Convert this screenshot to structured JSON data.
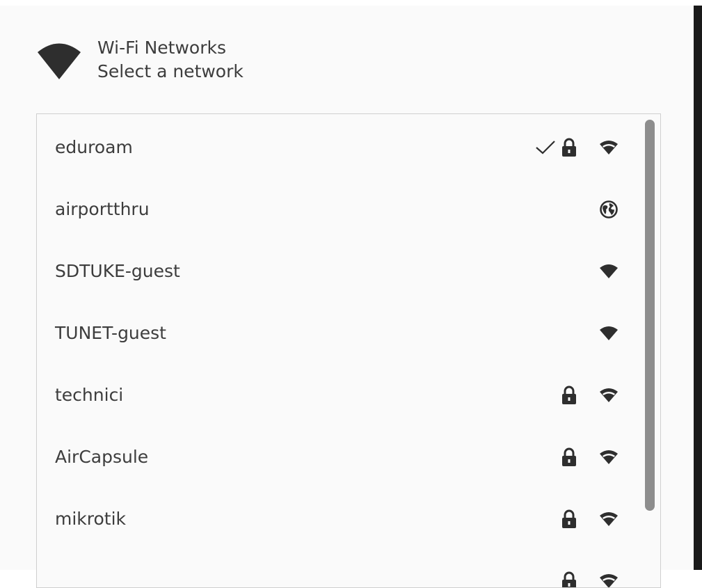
{
  "header": {
    "title": "Wi-Fi Networks",
    "subtitle": "Select a network",
    "icon": "wifi-signal-icon"
  },
  "networks": [
    {
      "name": "eduroam",
      "connected": true,
      "secured": true,
      "signal_icon": "wifi-signal-icon",
      "signal": "outline"
    },
    {
      "name": "airportthru",
      "connected": false,
      "secured": false,
      "signal_icon": "globe-icon",
      "signal": "globe"
    },
    {
      "name": "SDTUKE-guest",
      "connected": false,
      "secured": false,
      "signal_icon": "wifi-signal-icon",
      "signal": "full"
    },
    {
      "name": "TUNET-guest",
      "connected": false,
      "secured": false,
      "signal_icon": "wifi-signal-icon",
      "signal": "full"
    },
    {
      "name": "technici",
      "connected": false,
      "secured": true,
      "signal_icon": "wifi-signal-icon",
      "signal": "outline"
    },
    {
      "name": "AirCapsule",
      "connected": false,
      "secured": true,
      "signal_icon": "wifi-signal-icon",
      "signal": "outline"
    },
    {
      "name": "mikrotik",
      "connected": false,
      "secured": true,
      "signal_icon": "wifi-signal-icon",
      "signal": "outline"
    },
    {
      "name": "",
      "connected": false,
      "secured": true,
      "signal_icon": "wifi-signal-icon",
      "signal": "outline"
    }
  ],
  "colors": {
    "text": "#3d3d3d",
    "icon": "#2e2e2e",
    "background": "#fafafa",
    "border": "#cfcfcf",
    "scrollbar": "#8d8d8d"
  }
}
